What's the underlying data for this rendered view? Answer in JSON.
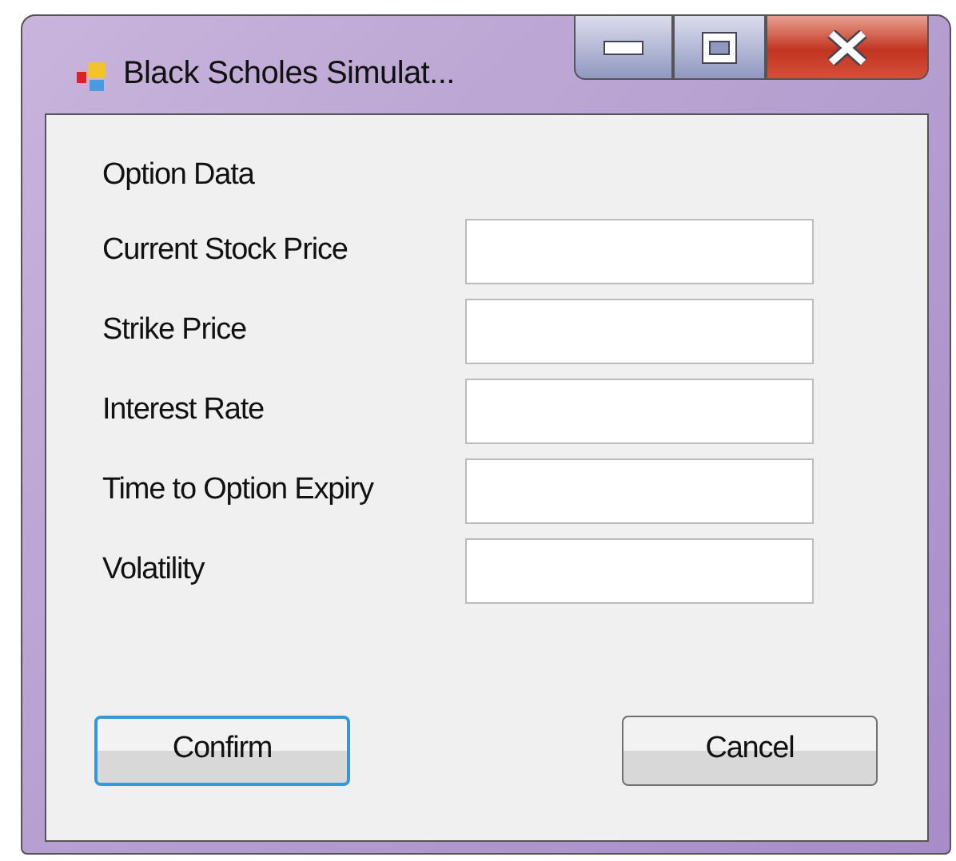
{
  "window": {
    "title": "Black Scholes Simulat..."
  },
  "heading": "Option Data",
  "fields": [
    {
      "label": "Current Stock Price"
    },
    {
      "label": "Strike Price"
    },
    {
      "label": "Interest Rate"
    },
    {
      "label": "Time to Option Expiry"
    },
    {
      "label": "Volatility"
    }
  ],
  "buttons": [
    {
      "label": "Confirm",
      "focused": true
    },
    {
      "label": "Cancel",
      "focused": false
    }
  ]
}
